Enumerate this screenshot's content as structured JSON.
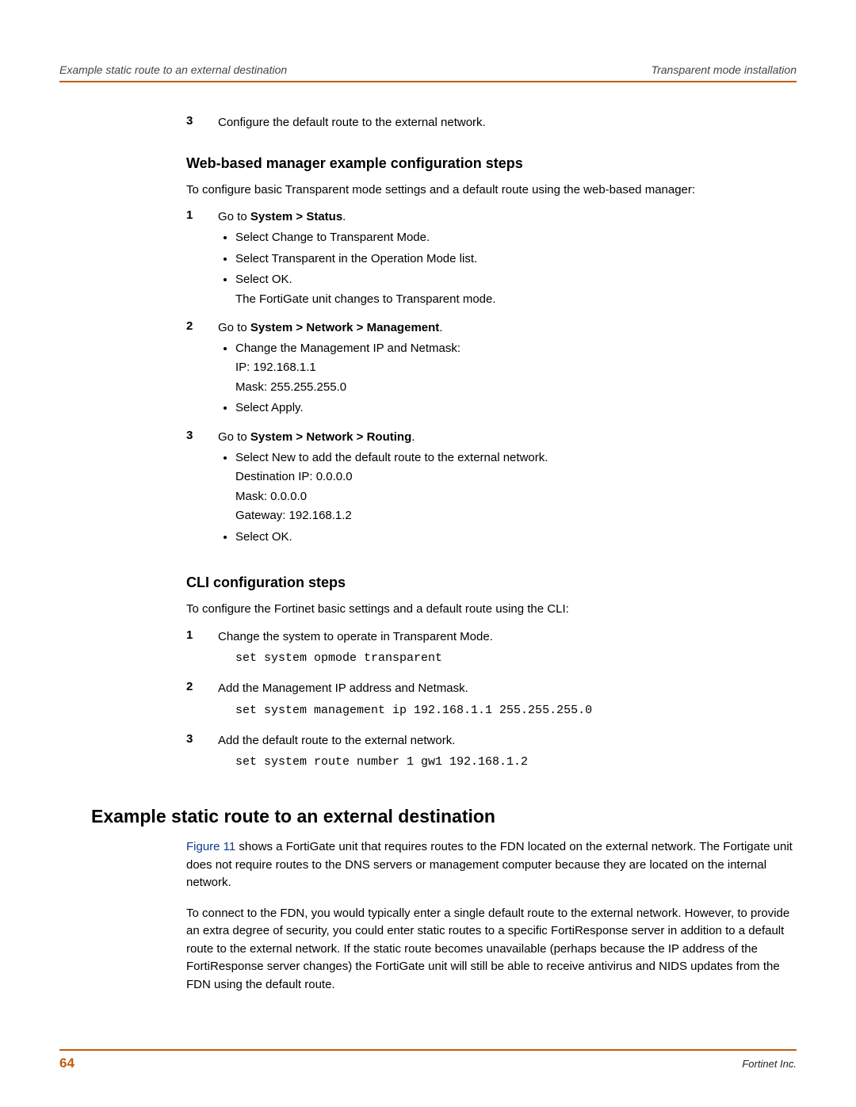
{
  "header": {
    "left": "Example static route to an external destination",
    "right": "Transparent mode installation"
  },
  "top_step": {
    "num": "3",
    "text": "Configure the default route to the external network."
  },
  "web_section": {
    "title": "Web-based manager example configuration steps",
    "intro": "To configure basic Transparent mode settings and a default route using the web-based manager:",
    "step1": {
      "num": "1",
      "prefix": "Go to ",
      "bold": "System > Status",
      "suffix": ".",
      "b1": "Select Change to Transparent Mode.",
      "b2": "Select Transparent in the Operation Mode list.",
      "b3": "Select OK.",
      "b3_extra": "The FortiGate unit changes to Transparent mode."
    },
    "step2": {
      "num": "2",
      "prefix": "Go to ",
      "bold": "System > Network > Management",
      "suffix": ".",
      "b1": "Change the Management IP and Netmask:",
      "b1_l1": "IP: 192.168.1.1",
      "b1_l2": "Mask: 255.255.255.0",
      "b2": "Select Apply."
    },
    "step3": {
      "num": "3",
      "prefix": "Go to ",
      "bold": "System > Network > Routing",
      "suffix": ".",
      "b1": "Select New to add the default route to the external network.",
      "b1_l1": "Destination IP: 0.0.0.0",
      "b1_l2": "Mask: 0.0.0.0",
      "b1_l3": "Gateway: 192.168.1.2",
      "b2": "Select OK."
    }
  },
  "cli_section": {
    "title": "CLI configuration steps",
    "intro": "To configure the Fortinet basic settings and a default route using the CLI:",
    "step1": {
      "num": "1",
      "text": "Change the system to operate in Transparent Mode.",
      "code": "set system opmode transparent"
    },
    "step2": {
      "num": "2",
      "text": "Add the Management IP address and Netmask.",
      "code": "set system management ip 192.168.1.1 255.255.255.0"
    },
    "step3": {
      "num": "3",
      "text": "Add the default route to the external network.",
      "code": "set system route number 1 gw1 192.168.1.2"
    }
  },
  "example_section": {
    "title": "Example static route to an external destination",
    "figlink": "Figure 11",
    "p1_rest": " shows a FortiGate unit that requires routes to the FDN located on the external network. The Fortigate unit does not require routes to the DNS servers or management computer because they are located on the internal network.",
    "p2": "To connect to the FDN, you would typically enter a single default route to the external network. However, to provide an extra degree of security, you could enter static routes to a specific FortiResponse server in addition to a default route to the external network. If the static route becomes unavailable (perhaps because the IP address of the FortiResponse server changes) the FortiGate unit will still be able to receive antivirus and NIDS updates from the FDN using the default route."
  },
  "footer": {
    "page": "64",
    "company": "Fortinet Inc."
  }
}
